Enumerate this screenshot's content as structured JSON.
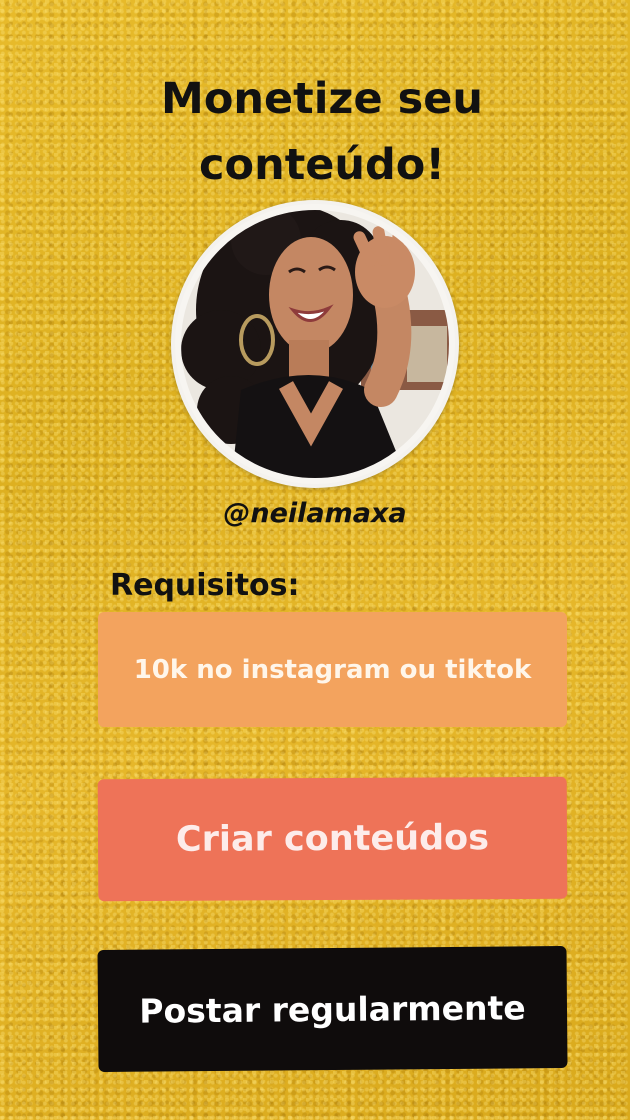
{
  "title": "Monetize seu\nconteúdo!",
  "profile": {
    "avatar_icon": "profile-photo",
    "handle": "@neilamaxa"
  },
  "requirements": {
    "label": "Requisitos:",
    "items": [
      {
        "label": "10k no instagram ou tiktok",
        "color": "#f3a35e"
      },
      {
        "label": "Criar conteúdos",
        "color": "#ee7358"
      },
      {
        "label": "Postar regularmente",
        "color": "#0f0c0c"
      }
    ]
  },
  "colors": {
    "background": "#e2b325",
    "text": "#111111"
  }
}
